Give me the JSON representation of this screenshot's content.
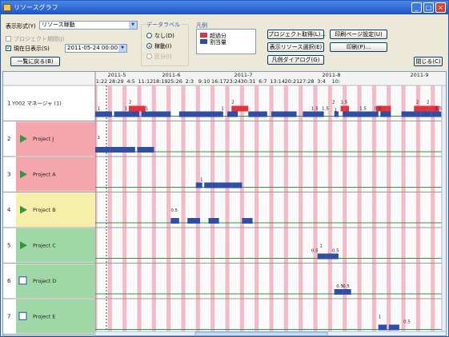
{
  "window": {
    "title": "リソースグラフ"
  },
  "toolbar": {
    "display_format_label": "表示形式(Y)",
    "display_format_value": "リソース稼動",
    "project_period_label": "プロジェクト期間(J)",
    "current_date_label": "現在日表示(S)",
    "current_date_value": "2011-05-24 00:00",
    "back_to_list_label": "一覧に戻る(B)",
    "data_label_title": "データラベル",
    "data_label_options": [
      "なし(D)",
      "稼動(I)",
      "区分(I)"
    ],
    "legend_title": "凡例",
    "legend_items": [
      {
        "label": "超過分",
        "color": "#e5333a"
      },
      {
        "label": "割当量",
        "color": "#2c4fa8"
      }
    ],
    "buttons": {
      "project_select": "プロジェクト取得(L)...",
      "print_setup": "印刷ページ設定(U)",
      "resource_select": "表示リソース選択(E)",
      "print": "印刷(P)...",
      "legend_dialog": "凡例ダイアログ(G)",
      "close": "閉じる(C)"
    }
  },
  "timeline": {
    "months": [
      "2011-5",
      "2011-6",
      "2011-7",
      "2011-8",
      "2011-9"
    ],
    "dates": [
      "1:22",
      "28:29",
      "4:5",
      "11:12",
      "18:19",
      "25:26",
      "2:3",
      "9:10",
      "16:17",
      "23:24",
      "30:31",
      "6:7",
      "13:14",
      "20:21",
      "27:28",
      "3:4",
      "10:"
    ]
  },
  "rows": [
    {
      "no": "1",
      "name": "Y002 マネージャ (1)",
      "color": "#ffffff",
      "icon": "none",
      "labels": [
        "1",
        "2",
        "1",
        "1",
        "2",
        "1",
        "1.5",
        "2",
        "1.5",
        "1",
        "1.5",
        "1.5",
        "0.5",
        "2",
        "1.5",
        "2"
      ]
    },
    {
      "no": "2",
      "name": "Project J",
      "color": "#f3a6ac",
      "icon": "play",
      "labels": [
        "1"
      ]
    },
    {
      "no": "3",
      "name": "Project A",
      "color": "#f3a6ac",
      "icon": "play",
      "labels": [
        "1"
      ]
    },
    {
      "no": "4",
      "name": "Project B",
      "color": "#f5efaa",
      "icon": "play",
      "labels": [
        "0.5"
      ]
    },
    {
      "no": "5",
      "name": "Project C",
      "color": "#9fd7a6",
      "icon": "play",
      "labels": [
        "0.5",
        "1",
        "0.5"
      ]
    },
    {
      "no": "6",
      "name": "Project D",
      "color": "#9fd7a6",
      "icon": "edit",
      "labels": [
        "0.5",
        "0.5"
      ]
    },
    {
      "no": "7",
      "name": "Project E",
      "color": "#9fd7a6",
      "icon": "edit",
      "labels": [
        "1",
        "0.5"
      ]
    }
  ]
}
